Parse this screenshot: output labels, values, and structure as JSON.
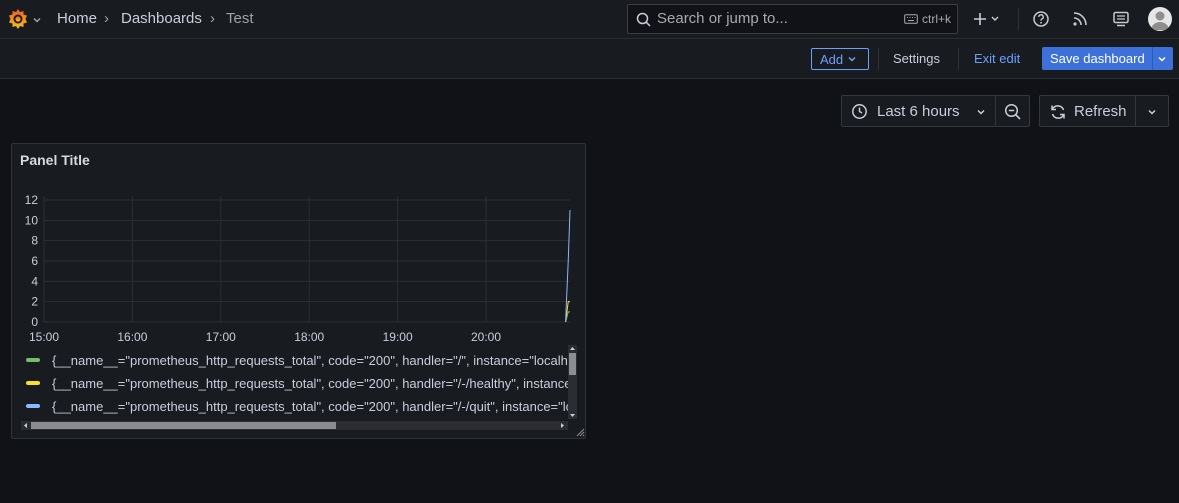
{
  "breadcrumb": {
    "home": "Home",
    "dashboards": "Dashboards",
    "current": "Test"
  },
  "search": {
    "placeholder": "Search or jump to...",
    "shortcut": "ctrl+k"
  },
  "toolbar": {
    "add_label": "Add",
    "settings_label": "Settings",
    "exit_label": "Exit edit",
    "save_label": "Save dashboard"
  },
  "time": {
    "range_label": "Last 6 hours",
    "refresh_label": "Refresh"
  },
  "panel": {
    "title": "Panel Title"
  },
  "colors": {
    "accent": "#3d71d9",
    "link": "#6e9fff",
    "series_green": "#73bf69",
    "series_yellow": "#fade2a",
    "series_blue": "#8ab8ff"
  },
  "chart_data": {
    "type": "line",
    "title": "Panel Title",
    "xlabel": "",
    "ylabel": "",
    "x_ticks": [
      "15:00",
      "16:00",
      "17:00",
      "18:00",
      "19:00",
      "20:00"
    ],
    "y_ticks": [
      0,
      2,
      4,
      6,
      8,
      10,
      12
    ],
    "ylim": [
      0,
      12
    ],
    "xlim_hours": [
      15.0,
      20.95
    ],
    "grid": true,
    "legend_position": "bottom",
    "series": [
      {
        "name": "{__name__=\"prometheus_http_requests_total\", code=\"200\", handler=\"/\", instance=\"localho",
        "color": "#73bf69",
        "x": [
          20.9,
          20.93,
          20.95
        ],
        "y": [
          0,
          1,
          1
        ]
      },
      {
        "name": "{__name__=\"prometheus_http_requests_total\", code=\"200\", handler=\"/-/healthy\", instance",
        "color": "#fade2a",
        "x": [
          20.9,
          20.93,
          20.95
        ],
        "y": [
          0,
          2,
          2
        ]
      },
      {
        "name": "{__name__=\"prometheus_http_requests_total\", code=\"200\", handler=\"/-/quit\", instance=\"lo",
        "color": "#8ab8ff",
        "x": [
          20.9,
          20.93,
          20.95
        ],
        "y": [
          0,
          6,
          11
        ]
      }
    ]
  }
}
